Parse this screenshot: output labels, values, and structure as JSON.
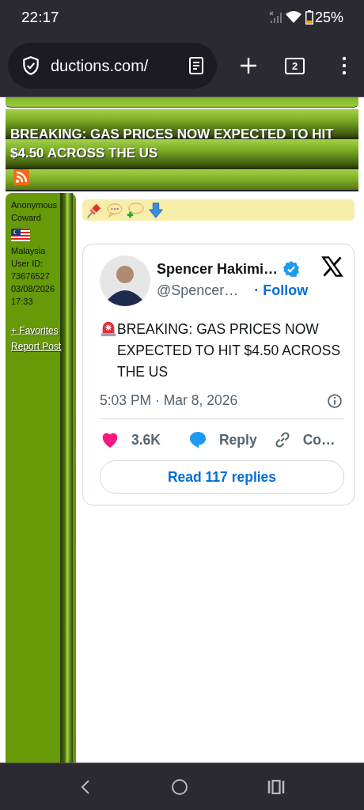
{
  "status_bar": {
    "time": "22:17",
    "battery": "25%"
  },
  "browser": {
    "url": "ductions.com/",
    "tab_count": "2"
  },
  "thread": {
    "title": "BREAKING: GAS PRICES NOW EXPECTED TO HIT $4.50 ACROSS THE US"
  },
  "post": {
    "author": "Anonymous Coward",
    "country": "Malaysia",
    "user_id": "User ID: 73676527",
    "date": "03/08/2026 17:33",
    "links": [
      "+ Favorites",
      "Report Post"
    ],
    "embed": {
      "name": "Spencer Hakimi…",
      "handle": "@Spencer…",
      "follow": "· Follow",
      "text": "BREAKING: GAS PRICES NOW EXPECTED TO HIT $4.50 ACROSS THE US",
      "time": "5:03 PM · Mar 8, 2026",
      "likes": "3.6K",
      "reply": "Reply",
      "copy": "Co…",
      "read_replies": "Read 117 replies"
    }
  }
}
